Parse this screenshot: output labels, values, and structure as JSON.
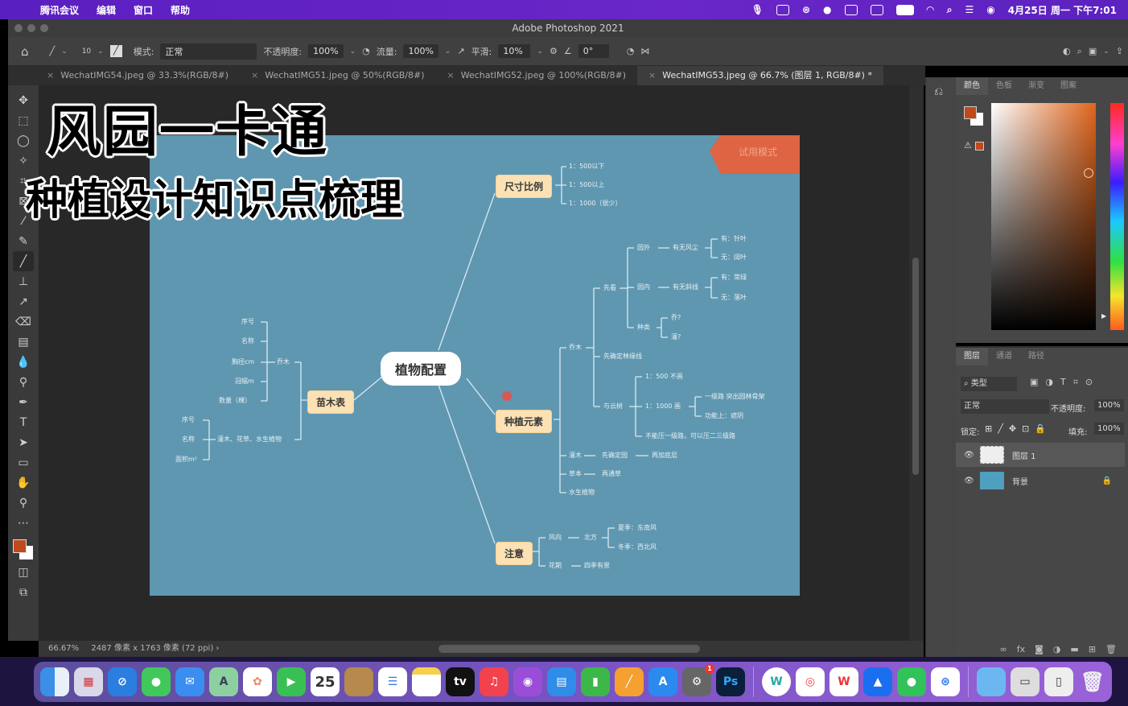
{
  "menubar": {
    "app": "腾讯会议",
    "items": [
      "编辑",
      "窗口",
      "帮助"
    ],
    "datetime": "4月25日 周一 下午7:01"
  },
  "window": {
    "title": "Adobe Photoshop 2021"
  },
  "options": {
    "brush_size": "10",
    "mode_label": "模式:",
    "mode_value": "正常",
    "opacity_label": "不透明度:",
    "opacity_value": "100%",
    "flow_label": "流量:",
    "flow_value": "100%",
    "smoothing_label": "平滑:",
    "smoothing_value": "10%",
    "angle_value": "0°"
  },
  "tabs": [
    {
      "label": "WechatIMG54.jpeg @ 33.3%(RGB/8#)"
    },
    {
      "label": "WechatIMG51.jpeg @ 50%(RGB/8#)"
    },
    {
      "label": "WechatIMG52.jpeg @ 100%(RGB/8#)"
    },
    {
      "label": "WechatIMG53.jpeg @ 66.7% (图层 1, RGB/8#) *"
    }
  ],
  "overlay": {
    "title": "风园一卡通",
    "subtitle": "种植设计知识点梳理"
  },
  "mindmap": {
    "root": "植物配置",
    "corner_label": "试用模式",
    "branches": {
      "size": {
        "label": "尺寸比例",
        "leaves": [
          "1：500以下",
          "1：500以上",
          "1：1000（很少）"
        ]
      },
      "elements": {
        "label": "种植元素",
        "arbor": "乔木",
        "first_look": "先看",
        "outside": "园外",
        "outside_sub": "有无风尘",
        "outside_yes": "有：针叶",
        "outside_no": "无：阔叶",
        "inside": "园内",
        "inside_sub": "有无斜线",
        "inside_yes": "有：常绿",
        "inside_no": "无：落叶",
        "species": "种类",
        "species_a": "乔?",
        "species_b": "灌?",
        "line": "先确定林缘线",
        "pattern": "与云树",
        "p1": "1：500 不画",
        "p2": "1：1000 画",
        "p2a": "一级路 突出园林骨架",
        "p2b": "功能上：遮阴",
        "p3": "不能压一级路，可以压二三级路",
        "shrub": "灌木",
        "shrub_a": "先确定园",
        "shrub_b": "再加底层",
        "grass": "草本",
        "grass_a": "再通草",
        "water": "水生植物"
      },
      "nursery": {
        "label": "苗木表",
        "arbor": "乔木",
        "arbor_leaves": [
          "序号",
          "名称",
          "胸径cm",
          "冠幅m",
          "数量（棵）"
        ],
        "shrub": "灌木、花草、水生植物",
        "shrub_leaves": [
          "序号",
          "名称",
          "面积m²"
        ]
      },
      "notes": {
        "label": "注意",
        "wind": "风向",
        "north": "北方",
        "summer": "夏季：东南风",
        "winter": "冬季：西北风",
        "flower": "花期",
        "season": "四季有景"
      }
    }
  },
  "color_panel": {
    "tabs": [
      "颜色",
      "色板",
      "渐变",
      "图案"
    ],
    "foreground": "#c04a1c",
    "background": "#ffffff"
  },
  "layers_panel": {
    "tabs": [
      "图层",
      "通道",
      "路径"
    ],
    "filter": "类型",
    "blend": "正常",
    "opacity_label": "不透明度:",
    "opacity": "100%",
    "lock_label": "锁定:",
    "fill_label": "填充:",
    "fill": "100%",
    "layers": [
      {
        "name": "图层 1",
        "visible": true,
        "selected": true
      },
      {
        "name": "背景",
        "visible": true,
        "locked": true
      }
    ]
  },
  "status": {
    "zoom": "66.67%",
    "dims": "2487 像素 x 1763 像素 (72 ppi)"
  },
  "dock": {
    "calendar_day": "25",
    "settings_badge": "1",
    "ps_label": "Ps",
    "tv_label": "tv"
  }
}
